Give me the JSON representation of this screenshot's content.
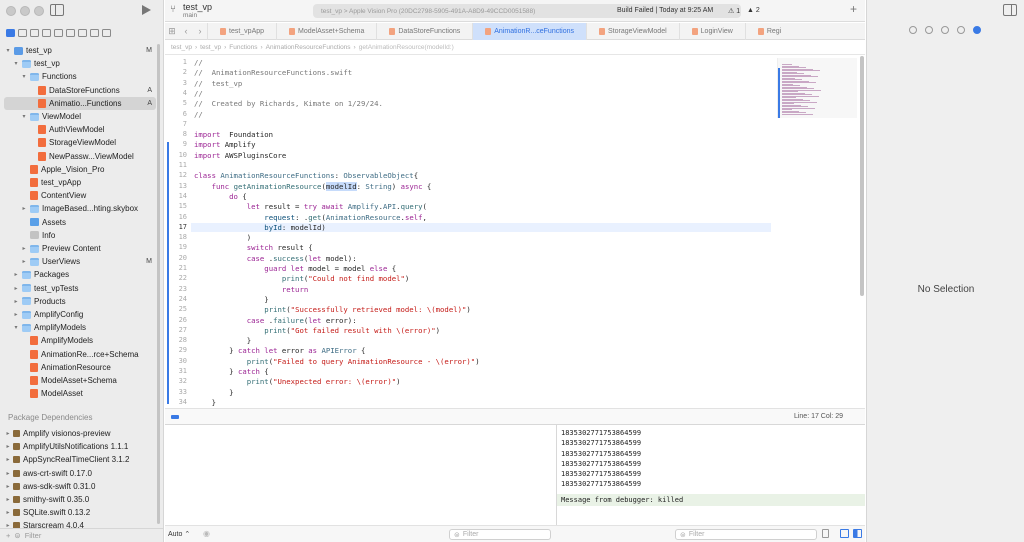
{
  "toolbar": {
    "project": "test_vp",
    "branch": "main",
    "destination": "test_vp > Apple Vision Pro (20DC2798-5905-491A-A8D9-49CCD0051588)",
    "build_status": "Build Failed | Today at 9:25 AM",
    "warnings": "1",
    "errors": "2"
  },
  "tabs": [
    "test_vpApp",
    "ModelAsset+Schema",
    "DataStoreFunctions",
    "AnimationR...ceFunctions",
    "StorageViewModel",
    "LoginView",
    "Regi"
  ],
  "breadcrumb": [
    "test_vp",
    "test_vp",
    "Functions",
    "AnimationResourceFunctions",
    "getAnimationResource(modelId:)"
  ],
  "navigator": {
    "tree": [
      {
        "label": "test_vp",
        "icon": "proj",
        "indent": 0,
        "chev": "v",
        "badge": "M"
      },
      {
        "label": "test_vp",
        "icon": "folder",
        "indent": 1,
        "chev": "v",
        "badge": ""
      },
      {
        "label": "Functions",
        "icon": "folder",
        "indent": 2,
        "chev": "v",
        "badge": ""
      },
      {
        "label": "DataStoreFunctions",
        "icon": "swift",
        "indent": 3,
        "chev": "",
        "badge": "A"
      },
      {
        "label": "Animatio...Functions",
        "icon": "swift",
        "indent": 3,
        "chev": "",
        "badge": "A",
        "selected": true
      },
      {
        "label": "ViewModel",
        "icon": "folder",
        "indent": 2,
        "chev": "v",
        "badge": ""
      },
      {
        "label": "AuthViewModel",
        "icon": "swift",
        "indent": 3,
        "chev": "",
        "badge": ""
      },
      {
        "label": "StorageViewModel",
        "icon": "swift",
        "indent": 3,
        "chev": "",
        "badge": ""
      },
      {
        "label": "NewPassw...ViewModel",
        "icon": "swift",
        "indent": 3,
        "chev": "",
        "badge": ""
      },
      {
        "label": "Apple_Vision_Pro",
        "icon": "swift",
        "indent": 2,
        "chev": "",
        "badge": ""
      },
      {
        "label": "test_vpApp",
        "icon": "swift",
        "indent": 2,
        "chev": "",
        "badge": ""
      },
      {
        "label": "ContentView",
        "icon": "swift",
        "indent": 2,
        "chev": "",
        "badge": ""
      },
      {
        "label": "ImageBased...hting.skybox",
        "icon": "folder",
        "indent": 2,
        "chev": ">",
        "badge": ""
      },
      {
        "label": "Assets",
        "icon": "asset",
        "indent": 2,
        "chev": "",
        "badge": ""
      },
      {
        "label": "Info",
        "icon": "plist",
        "indent": 2,
        "chev": "",
        "badge": ""
      },
      {
        "label": "Preview Content",
        "icon": "folder",
        "indent": 2,
        "chev": ">",
        "badge": ""
      },
      {
        "label": "UserViews",
        "icon": "folder",
        "indent": 2,
        "chev": ">",
        "badge": "M"
      },
      {
        "label": "Packages",
        "icon": "folder",
        "indent": 1,
        "chev": ">",
        "badge": ""
      },
      {
        "label": "test_vpTests",
        "icon": "folder",
        "indent": 1,
        "chev": ">",
        "badge": ""
      },
      {
        "label": "Products",
        "icon": "folder",
        "indent": 1,
        "chev": ">",
        "badge": ""
      },
      {
        "label": "AmplifyConfig",
        "icon": "folder",
        "indent": 1,
        "chev": ">",
        "badge": ""
      },
      {
        "label": "AmplifyModels",
        "icon": "folder",
        "indent": 1,
        "chev": "v",
        "badge": ""
      },
      {
        "label": "AmplifyModels",
        "icon": "swift",
        "indent": 2,
        "chev": "",
        "badge": ""
      },
      {
        "label": "AnimationRe...rce+Schema",
        "icon": "swift",
        "indent": 2,
        "chev": "",
        "badge": ""
      },
      {
        "label": "AnimationResource",
        "icon": "swift",
        "indent": 2,
        "chev": "",
        "badge": ""
      },
      {
        "label": "ModelAsset+Schema",
        "icon": "swift",
        "indent": 2,
        "chev": "",
        "badge": ""
      },
      {
        "label": "ModelAsset",
        "icon": "swift",
        "indent": 2,
        "chev": "",
        "badge": ""
      }
    ],
    "package_header": "Package Dependencies",
    "packages": [
      "Amplify visionos-preview",
      "AmplifyUtilsNotifications 1.1.1",
      "AppSyncRealTimeClient 3.1.2",
      "aws-crt-swift 0.17.0",
      "aws-sdk-swift 0.31.0",
      "smithy-swift 0.35.0",
      "SQLite.swift 0.13.2",
      "Starscream 4.0.4"
    ],
    "filter_placeholder": "Filter"
  },
  "editor": {
    "lines": [
      [
        [
          "cm",
          "//"
        ]
      ],
      [
        [
          "cm",
          "//  AnimationResourceFunctions.swift"
        ]
      ],
      [
        [
          "cm",
          "//  test_vp"
        ]
      ],
      [
        [
          "cm",
          "//"
        ]
      ],
      [
        [
          "cm",
          "//  Created by Richards, Kimate on 1/29/24."
        ]
      ],
      [
        [
          "cm",
          "//"
        ]
      ],
      [],
      [
        [
          "kw",
          "import"
        ],
        [
          "",
          "  Foundation"
        ]
      ],
      [
        [
          "kw",
          "import"
        ],
        [
          "",
          " Amplify"
        ]
      ],
      [
        [
          "kw",
          "import"
        ],
        [
          "",
          " AWSPluginsCore"
        ]
      ],
      [],
      [
        [
          "kw",
          "class"
        ],
        [
          "",
          " "
        ],
        [
          "ty",
          "AnimationResourceFunctions"
        ],
        [
          "",
          ": "
        ],
        [
          "ty",
          "ObservableObject"
        ],
        [
          "",
          "{"
        ]
      ],
      [
        [
          "",
          "    "
        ],
        [
          "kw",
          "func"
        ],
        [
          "",
          " "
        ],
        [
          "fn",
          "getAnimationResource"
        ],
        [
          "",
          "("
        ],
        [
          "hsel",
          "modelId"
        ],
        [
          "",
          ": "
        ],
        [
          "ty",
          "String"
        ],
        [
          "",
          ") "
        ],
        [
          "kw",
          "async"
        ],
        [
          "",
          " {"
        ]
      ],
      [
        [
          "",
          "        "
        ],
        [
          "kw",
          "do"
        ],
        [
          "",
          " {"
        ]
      ],
      [
        [
          "",
          "            "
        ],
        [
          "kw",
          "let"
        ],
        [
          "",
          " result = "
        ],
        [
          "kw",
          "try await"
        ],
        [
          "",
          " "
        ],
        [
          "ty",
          "Amplify"
        ],
        [
          "",
          "."
        ],
        [
          "ty",
          "API"
        ],
        [
          "",
          "."
        ],
        [
          "fn",
          "query"
        ],
        [
          "",
          "("
        ]
      ],
      [
        [
          "",
          "                "
        ],
        [
          "pm",
          "request"
        ],
        [
          "",
          ": ."
        ],
        [
          "fn",
          "get"
        ],
        [
          "",
          "("
        ],
        [
          "ty",
          "AnimationResource"
        ],
        [
          "",
          "."
        ],
        [
          "kw",
          "self"
        ],
        [
          "",
          ","
        ]
      ],
      [
        [
          "",
          "                "
        ],
        [
          "pm",
          "byId"
        ],
        [
          "",
          ": modelId)"
        ]
      ],
      [
        [
          "",
          "            )"
        ]
      ],
      [
        [
          "",
          "            "
        ],
        [
          "kw",
          "switch"
        ],
        [
          "",
          " result {"
        ]
      ],
      [
        [
          "",
          "            "
        ],
        [
          "kw",
          "case"
        ],
        [
          "",
          " ."
        ],
        [
          "fn",
          "success"
        ],
        [
          "",
          "("
        ],
        [
          "kw",
          "let"
        ],
        [
          "",
          " model):"
        ]
      ],
      [
        [
          "",
          "                "
        ],
        [
          "kw",
          "guard"
        ],
        [
          "",
          " "
        ],
        [
          "kw",
          "let"
        ],
        [
          "",
          " model = model "
        ],
        [
          "kw",
          "else"
        ],
        [
          "",
          " {"
        ]
      ],
      [
        [
          "",
          "                    "
        ],
        [
          "fn",
          "print"
        ],
        [
          "",
          "("
        ],
        [
          "st",
          "\"Could not find model\""
        ],
        [
          "",
          ")"
        ]
      ],
      [
        [
          "",
          "                    "
        ],
        [
          "kw",
          "return"
        ]
      ],
      [
        [
          "",
          "                }"
        ]
      ],
      [
        [
          "",
          "                "
        ],
        [
          "fn",
          "print"
        ],
        [
          "",
          "("
        ],
        [
          "st",
          "\"Successfully retrieved model: \\(model)\""
        ],
        [
          "",
          ")"
        ]
      ],
      [
        [
          "",
          "            "
        ],
        [
          "kw",
          "case"
        ],
        [
          "",
          " ."
        ],
        [
          "fn",
          "failure"
        ],
        [
          "",
          "("
        ],
        [
          "kw",
          "let"
        ],
        [
          "",
          " error):"
        ]
      ],
      [
        [
          "",
          "                "
        ],
        [
          "fn",
          "print"
        ],
        [
          "",
          "("
        ],
        [
          "st",
          "\"Got failed result with \\(error)\""
        ],
        [
          "",
          ")"
        ]
      ],
      [
        [
          "",
          "            }"
        ]
      ],
      [
        [
          "",
          "        } "
        ],
        [
          "kw",
          "catch let"
        ],
        [
          "",
          " error "
        ],
        [
          "kw",
          "as"
        ],
        [
          "",
          " "
        ],
        [
          "ty",
          "APIError"
        ],
        [
          "",
          " {"
        ]
      ],
      [
        [
          "",
          "            "
        ],
        [
          "fn",
          "print"
        ],
        [
          "",
          "("
        ],
        [
          "st",
          "\"Failed to query AnimationResource - \\(error)\""
        ],
        [
          "",
          ")"
        ]
      ],
      [
        [
          "",
          "        } "
        ],
        [
          "kw",
          "catch"
        ],
        [
          "",
          " {"
        ]
      ],
      [
        [
          "",
          "            "
        ],
        [
          "fn",
          "print"
        ],
        [
          "",
          "("
        ],
        [
          "st",
          "\"Unexpected error: \\(error)\""
        ],
        [
          "",
          ")"
        ]
      ],
      [
        [
          "",
          "        }"
        ]
      ],
      [
        [
          "",
          "    }"
        ]
      ],
      [
        [
          "",
          "}"
        ]
      ]
    ],
    "current_line": 17,
    "status": "Line: 17  Col: 29"
  },
  "debug": {
    "console_lines": [
      "1835302771753864599 7",
      "1835302771753864599",
      "1835302771753864599",
      "1835302771753864599",
      "1835302771753864599",
      "1835302771753864599",
      "1835302771753864599"
    ],
    "killed": "Message from debugger: killed",
    "auto": "Auto",
    "filter": "Filter"
  },
  "inspector": {
    "empty": "No Selection"
  }
}
